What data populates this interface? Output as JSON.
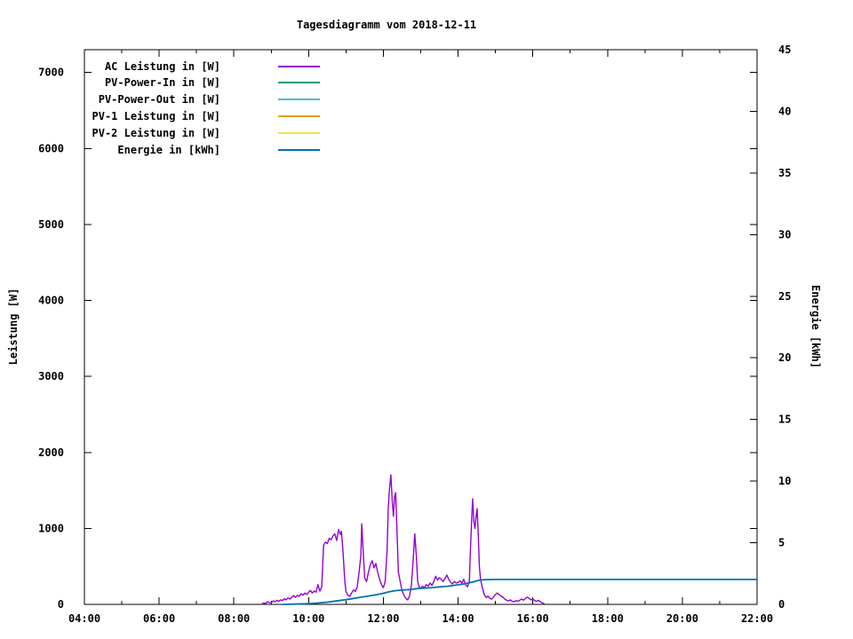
{
  "chart_data": {
    "type": "line",
    "title": "Tagesdiagramm vom 2018-12-11",
    "xlabel": "",
    "ylabel": "Leistung [W]",
    "y2label": "Energie [kWh]",
    "x_unit": "time-of-day (hours)",
    "x_range_hours": [
      4,
      22
    ],
    "x_major_tick_hours": [
      4,
      6,
      8,
      10,
      12,
      14,
      16,
      18,
      20,
      22
    ],
    "x_major_tick_labels": [
      "04:00",
      "06:00",
      "08:00",
      "10:00",
      "12:00",
      "14:00",
      "16:00",
      "18:00",
      "20:00",
      "22:00"
    ],
    "x_minor_tick_step_hours": 1,
    "y_left_range": [
      0,
      7300
    ],
    "y_left_ticks": [
      0,
      1000,
      2000,
      3000,
      4000,
      5000,
      6000,
      7000
    ],
    "y_right_range": [
      0,
      45
    ],
    "y_right_ticks": [
      0,
      5,
      10,
      15,
      20,
      25,
      30,
      35,
      40,
      45
    ],
    "grid": false,
    "legend_position": "top-left-inside",
    "series": [
      {
        "label": "AC Leistung in [W]",
        "color": "#9400d3",
        "axis": "left",
        "visible_in_plot": true,
        "points": [
          [
            8.75,
            5
          ],
          [
            8.8,
            20
          ],
          [
            8.85,
            10
          ],
          [
            8.9,
            35
          ],
          [
            8.95,
            25
          ],
          [
            9.0,
            20
          ],
          [
            9.05,
            45
          ],
          [
            9.1,
            35
          ],
          [
            9.15,
            55
          ],
          [
            9.2,
            40
          ],
          [
            9.25,
            60
          ],
          [
            9.3,
            50
          ],
          [
            9.35,
            75
          ],
          [
            9.4,
            60
          ],
          [
            9.45,
            85
          ],
          [
            9.5,
            70
          ],
          [
            9.55,
            95
          ],
          [
            9.6,
            115
          ],
          [
            9.65,
            95
          ],
          [
            9.7,
            120
          ],
          [
            9.75,
            105
          ],
          [
            9.8,
            140
          ],
          [
            9.85,
            120
          ],
          [
            9.9,
            150
          ],
          [
            9.95,
            130
          ],
          [
            10.0,
            160
          ],
          [
            10.05,
            185
          ],
          [
            10.1,
            150
          ],
          [
            10.15,
            175
          ],
          [
            10.2,
            160
          ],
          [
            10.25,
            260
          ],
          [
            10.3,
            175
          ],
          [
            10.35,
            230
          ],
          [
            10.4,
            780
          ],
          [
            10.45,
            820
          ],
          [
            10.5,
            800
          ],
          [
            10.55,
            870
          ],
          [
            10.6,
            850
          ],
          [
            10.65,
            900
          ],
          [
            10.7,
            930
          ],
          [
            10.75,
            840
          ],
          [
            10.8,
            985
          ],
          [
            10.85,
            920
          ],
          [
            10.88,
            960
          ],
          [
            10.92,
            700
          ],
          [
            10.97,
            300
          ],
          [
            11.0,
            170
          ],
          [
            11.05,
            120
          ],
          [
            11.1,
            105
          ],
          [
            11.15,
            150
          ],
          [
            11.2,
            190
          ],
          [
            11.25,
            170
          ],
          [
            11.3,
            230
          ],
          [
            11.35,
            420
          ],
          [
            11.4,
            650
          ],
          [
            11.42,
            1060
          ],
          [
            11.45,
            800
          ],
          [
            11.5,
            350
          ],
          [
            11.55,
            300
          ],
          [
            11.6,
            420
          ],
          [
            11.65,
            520
          ],
          [
            11.7,
            575
          ],
          [
            11.75,
            480
          ],
          [
            11.8,
            540
          ],
          [
            11.85,
            420
          ],
          [
            11.9,
            330
          ],
          [
            11.95,
            260
          ],
          [
            12.0,
            220
          ],
          [
            12.05,
            300
          ],
          [
            12.1,
            700
          ],
          [
            12.13,
            1250
          ],
          [
            12.16,
            1500
          ],
          [
            12.2,
            1705
          ],
          [
            12.24,
            1350
          ],
          [
            12.27,
            1160
          ],
          [
            12.3,
            1420
          ],
          [
            12.33,
            1470
          ],
          [
            12.37,
            900
          ],
          [
            12.4,
            430
          ],
          [
            12.45,
            300
          ],
          [
            12.5,
            180
          ],
          [
            12.55,
            120
          ],
          [
            12.6,
            80
          ],
          [
            12.65,
            60
          ],
          [
            12.7,
            110
          ],
          [
            12.75,
            250
          ],
          [
            12.8,
            600
          ],
          [
            12.84,
            930
          ],
          [
            12.88,
            650
          ],
          [
            12.92,
            300
          ],
          [
            12.96,
            230
          ],
          [
            13.0,
            210
          ],
          [
            13.05,
            240
          ],
          [
            13.1,
            220
          ],
          [
            13.15,
            260
          ],
          [
            13.2,
            240
          ],
          [
            13.25,
            280
          ],
          [
            13.3,
            250
          ],
          [
            13.35,
            300
          ],
          [
            13.4,
            370
          ],
          [
            13.45,
            320
          ],
          [
            13.5,
            350
          ],
          [
            13.55,
            330
          ],
          [
            13.6,
            300
          ],
          [
            13.65,
            340
          ],
          [
            13.7,
            385
          ],
          [
            13.75,
            330
          ],
          [
            13.8,
            290
          ],
          [
            13.85,
            270
          ],
          [
            13.9,
            300
          ],
          [
            13.95,
            280
          ],
          [
            14.0,
            290
          ],
          [
            14.05,
            310
          ],
          [
            14.1,
            280
          ],
          [
            14.15,
            330
          ],
          [
            14.2,
            260
          ],
          [
            14.25,
            230
          ],
          [
            14.3,
            300
          ],
          [
            14.33,
            700
          ],
          [
            14.37,
            1200
          ],
          [
            14.39,
            1390
          ],
          [
            14.42,
            1100
          ],
          [
            14.45,
            1000
          ],
          [
            14.48,
            1150
          ],
          [
            14.51,
            1260
          ],
          [
            14.54,
            900
          ],
          [
            14.57,
            500
          ],
          [
            14.6,
            330
          ],
          [
            14.65,
            220
          ],
          [
            14.7,
            130
          ],
          [
            14.75,
            90
          ],
          [
            14.8,
            110
          ],
          [
            14.85,
            80
          ],
          [
            14.9,
            70
          ],
          [
            14.95,
            100
          ],
          [
            15.0,
            130
          ],
          [
            15.05,
            150
          ],
          [
            15.1,
            130
          ],
          [
            15.15,
            110
          ],
          [
            15.2,
            95
          ],
          [
            15.25,
            70
          ],
          [
            15.3,
            55
          ],
          [
            15.35,
            45
          ],
          [
            15.4,
            60
          ],
          [
            15.45,
            40
          ],
          [
            15.5,
            35
          ],
          [
            15.55,
            50
          ],
          [
            15.6,
            40
          ],
          [
            15.65,
            55
          ],
          [
            15.7,
            70
          ],
          [
            15.75,
            55
          ],
          [
            15.8,
            80
          ],
          [
            15.85,
            95
          ],
          [
            15.9,
            80
          ],
          [
            15.95,
            60
          ],
          [
            16.0,
            70
          ],
          [
            16.05,
            50
          ],
          [
            16.1,
            40
          ],
          [
            16.15,
            55
          ],
          [
            16.2,
            35
          ],
          [
            16.25,
            20
          ],
          [
            16.3,
            10
          ]
        ]
      },
      {
        "label": "PV-Power-In in [W]",
        "color": "#009e73",
        "axis": "left",
        "visible_in_plot": false,
        "points": []
      },
      {
        "label": "PV-Power-Out in [W]",
        "color": "#56b4e9",
        "axis": "left",
        "visible_in_plot": false,
        "points": []
      },
      {
        "label": "PV-1 Leistung in [W]",
        "color": "#e69f00",
        "axis": "left",
        "visible_in_plot": false,
        "points": []
      },
      {
        "label": "PV-2 Leistung in [W]",
        "color": "#f0e442",
        "axis": "left",
        "visible_in_plot": false,
        "points": []
      },
      {
        "label": "Energie in [kWh]",
        "color": "#0072b2",
        "axis": "right",
        "visible_in_plot": true,
        "points": [
          [
            9.3,
            0.0
          ],
          [
            9.6,
            0.02
          ],
          [
            9.9,
            0.05
          ],
          [
            10.2,
            0.1
          ],
          [
            10.5,
            0.18
          ],
          [
            10.8,
            0.3
          ],
          [
            11.0,
            0.38
          ],
          [
            11.2,
            0.48
          ],
          [
            11.4,
            0.58
          ],
          [
            11.6,
            0.68
          ],
          [
            11.8,
            0.78
          ],
          [
            12.0,
            0.9
          ],
          [
            12.1,
            0.98
          ],
          [
            12.2,
            1.05
          ],
          [
            12.35,
            1.12
          ],
          [
            12.5,
            1.16
          ],
          [
            12.7,
            1.2
          ],
          [
            12.9,
            1.28
          ],
          [
            13.1,
            1.32
          ],
          [
            13.3,
            1.36
          ],
          [
            13.5,
            1.42
          ],
          [
            13.7,
            1.47
          ],
          [
            13.9,
            1.55
          ],
          [
            14.1,
            1.63
          ],
          [
            14.25,
            1.72
          ],
          [
            14.4,
            1.82
          ],
          [
            14.55,
            1.95
          ],
          [
            14.7,
            2.0
          ],
          [
            15.0,
            2.02
          ],
          [
            16.0,
            2.02
          ],
          [
            18.0,
            2.02
          ],
          [
            20.0,
            2.02
          ],
          [
            22.0,
            2.02
          ]
        ]
      }
    ]
  },
  "colors": {
    "background": "#ffffff",
    "axis": "#000000",
    "text": "#000000"
  }
}
